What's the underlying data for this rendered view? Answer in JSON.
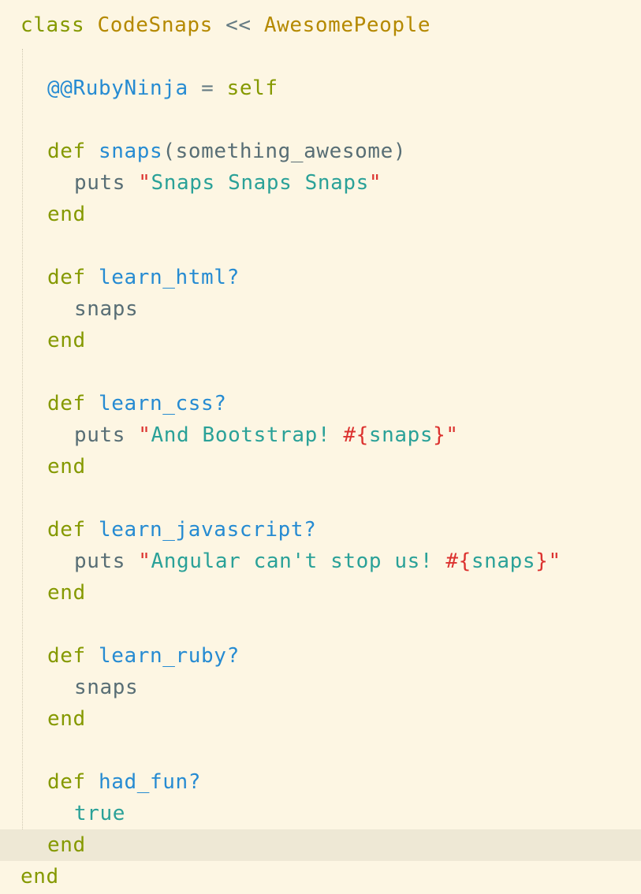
{
  "code": {
    "class_kw": "class",
    "class_name": "CodeSnaps",
    "inherit_op": "<<",
    "parent_name": "AwesomePeople",
    "ivar_name": "@@RubyNinja",
    "assign_op": "=",
    "self_kw": "self",
    "def_kw": "def",
    "end_kw": "end",
    "puts_kw": "puts",
    "quote": "\"",
    "interp_open": "#{",
    "interp_close": "}",
    "methods": {
      "snaps": {
        "name": "snaps",
        "params": "(something_awesome)",
        "string_text": "Snaps Snaps Snaps"
      },
      "learn_html": {
        "name": "learn_html?",
        "body": "snaps"
      },
      "learn_css": {
        "name": "learn_css?",
        "string_text": "And Bootstrap! ",
        "interp_inner": "snaps"
      },
      "learn_javascript": {
        "name": "learn_javascript?",
        "string_text": "Angular can't stop us! ",
        "interp_inner": "snaps"
      },
      "learn_ruby": {
        "name": "learn_ruby?",
        "body": "snaps"
      },
      "had_fun": {
        "name": "had_fun?",
        "body": "true"
      }
    }
  }
}
